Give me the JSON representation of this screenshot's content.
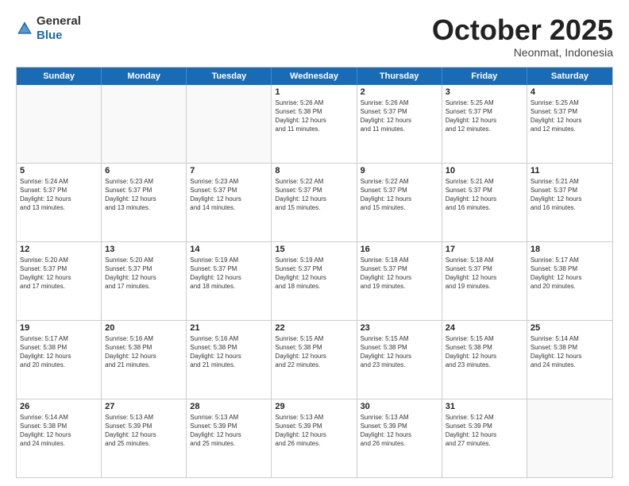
{
  "header": {
    "logo": {
      "general": "General",
      "blue": "Blue"
    },
    "month": "October 2025",
    "location": "Neonmat, Indonesia"
  },
  "weekdays": [
    "Sunday",
    "Monday",
    "Tuesday",
    "Wednesday",
    "Thursday",
    "Friday",
    "Saturday"
  ],
  "weeks": [
    [
      {
        "day": "",
        "info": ""
      },
      {
        "day": "",
        "info": ""
      },
      {
        "day": "",
        "info": ""
      },
      {
        "day": "1",
        "info": "Sunrise: 5:26 AM\nSunset: 5:38 PM\nDaylight: 12 hours\nand 11 minutes."
      },
      {
        "day": "2",
        "info": "Sunrise: 5:26 AM\nSunset: 5:37 PM\nDaylight: 12 hours\nand 11 minutes."
      },
      {
        "day": "3",
        "info": "Sunrise: 5:25 AM\nSunset: 5:37 PM\nDaylight: 12 hours\nand 12 minutes."
      },
      {
        "day": "4",
        "info": "Sunrise: 5:25 AM\nSunset: 5:37 PM\nDaylight: 12 hours\nand 12 minutes."
      }
    ],
    [
      {
        "day": "5",
        "info": "Sunrise: 5:24 AM\nSunset: 5:37 PM\nDaylight: 12 hours\nand 13 minutes."
      },
      {
        "day": "6",
        "info": "Sunrise: 5:23 AM\nSunset: 5:37 PM\nDaylight: 12 hours\nand 13 minutes."
      },
      {
        "day": "7",
        "info": "Sunrise: 5:23 AM\nSunset: 5:37 PM\nDaylight: 12 hours\nand 14 minutes."
      },
      {
        "day": "8",
        "info": "Sunrise: 5:22 AM\nSunset: 5:37 PM\nDaylight: 12 hours\nand 15 minutes."
      },
      {
        "day": "9",
        "info": "Sunrise: 5:22 AM\nSunset: 5:37 PM\nDaylight: 12 hours\nand 15 minutes."
      },
      {
        "day": "10",
        "info": "Sunrise: 5:21 AM\nSunset: 5:37 PM\nDaylight: 12 hours\nand 16 minutes."
      },
      {
        "day": "11",
        "info": "Sunrise: 5:21 AM\nSunset: 5:37 PM\nDaylight: 12 hours\nand 16 minutes."
      }
    ],
    [
      {
        "day": "12",
        "info": "Sunrise: 5:20 AM\nSunset: 5:37 PM\nDaylight: 12 hours\nand 17 minutes."
      },
      {
        "day": "13",
        "info": "Sunrise: 5:20 AM\nSunset: 5:37 PM\nDaylight: 12 hours\nand 17 minutes."
      },
      {
        "day": "14",
        "info": "Sunrise: 5:19 AM\nSunset: 5:37 PM\nDaylight: 12 hours\nand 18 minutes."
      },
      {
        "day": "15",
        "info": "Sunrise: 5:19 AM\nSunset: 5:37 PM\nDaylight: 12 hours\nand 18 minutes."
      },
      {
        "day": "16",
        "info": "Sunrise: 5:18 AM\nSunset: 5:37 PM\nDaylight: 12 hours\nand 19 minutes."
      },
      {
        "day": "17",
        "info": "Sunrise: 5:18 AM\nSunset: 5:37 PM\nDaylight: 12 hours\nand 19 minutes."
      },
      {
        "day": "18",
        "info": "Sunrise: 5:17 AM\nSunset: 5:38 PM\nDaylight: 12 hours\nand 20 minutes."
      }
    ],
    [
      {
        "day": "19",
        "info": "Sunrise: 5:17 AM\nSunset: 5:38 PM\nDaylight: 12 hours\nand 20 minutes."
      },
      {
        "day": "20",
        "info": "Sunrise: 5:16 AM\nSunset: 5:38 PM\nDaylight: 12 hours\nand 21 minutes."
      },
      {
        "day": "21",
        "info": "Sunrise: 5:16 AM\nSunset: 5:38 PM\nDaylight: 12 hours\nand 21 minutes."
      },
      {
        "day": "22",
        "info": "Sunrise: 5:15 AM\nSunset: 5:38 PM\nDaylight: 12 hours\nand 22 minutes."
      },
      {
        "day": "23",
        "info": "Sunrise: 5:15 AM\nSunset: 5:38 PM\nDaylight: 12 hours\nand 23 minutes."
      },
      {
        "day": "24",
        "info": "Sunrise: 5:15 AM\nSunset: 5:38 PM\nDaylight: 12 hours\nand 23 minutes."
      },
      {
        "day": "25",
        "info": "Sunrise: 5:14 AM\nSunset: 5:38 PM\nDaylight: 12 hours\nand 24 minutes."
      }
    ],
    [
      {
        "day": "26",
        "info": "Sunrise: 5:14 AM\nSunset: 5:38 PM\nDaylight: 12 hours\nand 24 minutes."
      },
      {
        "day": "27",
        "info": "Sunrise: 5:13 AM\nSunset: 5:39 PM\nDaylight: 12 hours\nand 25 minutes."
      },
      {
        "day": "28",
        "info": "Sunrise: 5:13 AM\nSunset: 5:39 PM\nDaylight: 12 hours\nand 25 minutes."
      },
      {
        "day": "29",
        "info": "Sunrise: 5:13 AM\nSunset: 5:39 PM\nDaylight: 12 hours\nand 26 minutes."
      },
      {
        "day": "30",
        "info": "Sunrise: 5:13 AM\nSunset: 5:39 PM\nDaylight: 12 hours\nand 26 minutes."
      },
      {
        "day": "31",
        "info": "Sunrise: 5:12 AM\nSunset: 5:39 PM\nDaylight: 12 hours\nand 27 minutes."
      },
      {
        "day": "",
        "info": ""
      }
    ]
  ]
}
